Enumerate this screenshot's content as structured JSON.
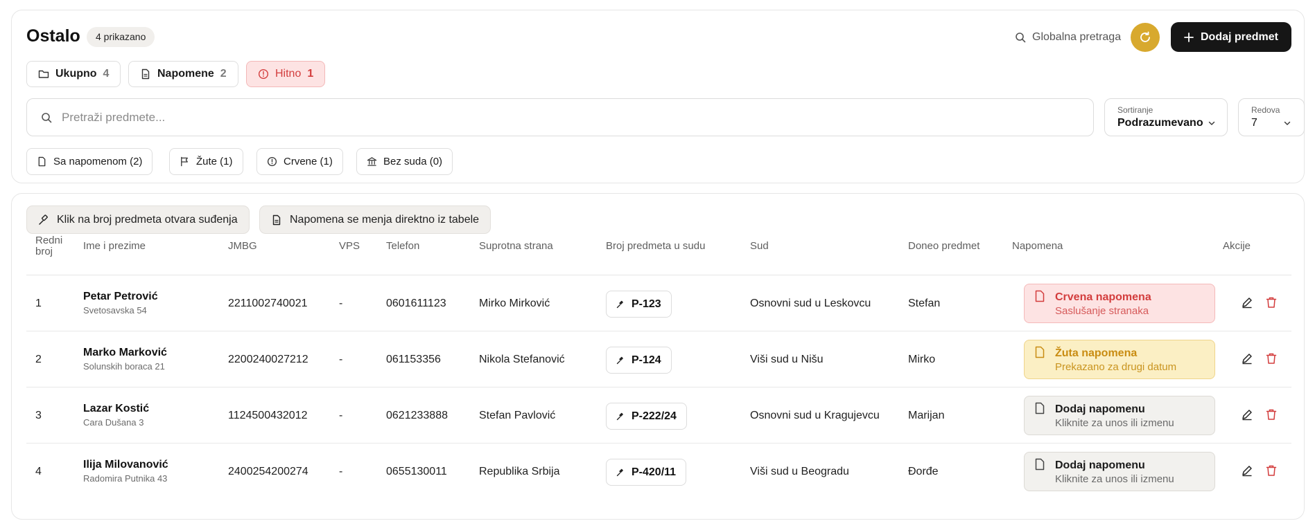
{
  "header": {
    "title": "Ostalo",
    "shown_count": "4 prikazano",
    "global_search_label": "Globalna pretraga",
    "add_button_label": "Dodaj predmet",
    "accent_color": "#d8a92e"
  },
  "stat_tabs": [
    {
      "label": "Ukupno",
      "count": "4",
      "icon": "folder-icon"
    },
    {
      "label": "Napomene",
      "count": "2",
      "icon": "document-icon"
    },
    {
      "label": "Hitno",
      "count": "1",
      "icon": "alert-circle-icon"
    }
  ],
  "search": {
    "placeholder": "Pretraži predmete..."
  },
  "sort": {
    "label": "Sortiranje",
    "value": "Podrazumevano"
  },
  "rows_per_page": {
    "label": "Redova",
    "value": "7"
  },
  "filters": [
    {
      "label": "Sa napomenom (2)",
      "icon": "document-icon"
    },
    {
      "label": "Žute (1)",
      "icon": "flag-icon"
    },
    {
      "label": "Crvene (1)",
      "icon": "alert-circle-icon"
    },
    {
      "label": "Bez suda (0)",
      "icon": "courthouse-icon"
    }
  ],
  "hints": [
    {
      "label": "Klik na broj predmeta otvara suđenja",
      "icon": "gavel-icon"
    },
    {
      "label": "Napomena se menja direktno iz tabele",
      "icon": "document-icon"
    }
  ],
  "table": {
    "columns": {
      "redni_broj_1": "Redni",
      "redni_broj_2": "broj",
      "ime": "Ime i prezime",
      "jmbg": "JMBG",
      "vps": "VPS",
      "telefon": "Telefon",
      "suprotna": "Suprotna strana",
      "broj_predmeta": "Broj predmeta u sudu",
      "sud": "Sud",
      "doneo": "Doneo predmet",
      "napomena": "Napomena",
      "akcije": "Akcije"
    },
    "rows": [
      {
        "num": "1",
        "name": "Petar Petrović",
        "address": "Svetosavska 54",
        "jmbg": "2211002740021",
        "vps": "-",
        "phone": "0601611123",
        "opposing": "Mirko Mirković",
        "case": "P-123",
        "court": "Osnovni sud u Leskovcu",
        "brought_by": "Stefan",
        "note_title": "Crvena napomena",
        "note_sub": "Saslušanje stranaka",
        "note_type": "red"
      },
      {
        "num": "2",
        "name": "Marko Marković",
        "address": "Solunskih boraca 21",
        "jmbg": "2200240027212",
        "vps": "-",
        "phone": "061153356",
        "opposing": "Nikola Stefanović",
        "case": "P-124",
        "court": "Viši sud u Nišu",
        "brought_by": "Mirko",
        "note_title": "Žuta napomena",
        "note_sub": "Prekazano za drugi datum",
        "note_type": "yellow"
      },
      {
        "num": "3",
        "name": "Lazar Kostić",
        "address": "Cara Dušana 3",
        "jmbg": "1124500432012",
        "vps": "-",
        "phone": "0621233888",
        "opposing": "Stefan Pavlović",
        "case": "P-222/24",
        "court": "Osnovni sud u Kragujevcu",
        "brought_by": "Marijan",
        "note_title": "Dodaj napomenu",
        "note_sub": "Kliknite za unos ili izmenu",
        "note_type": "gray"
      },
      {
        "num": "4",
        "name": "Ilija Milovanović",
        "address": "Radomira Putnika 43",
        "jmbg": "2400254200274",
        "vps": "-",
        "phone": "0655130011",
        "opposing": "Republika Srbija",
        "case": "P-420/11",
        "court": "Viši sud u Beogradu",
        "brought_by": "Đorđe",
        "note_title": "Dodaj napomenu",
        "note_sub": "Kliknite za unos ili izmenu",
        "note_type": "gray"
      }
    ]
  }
}
